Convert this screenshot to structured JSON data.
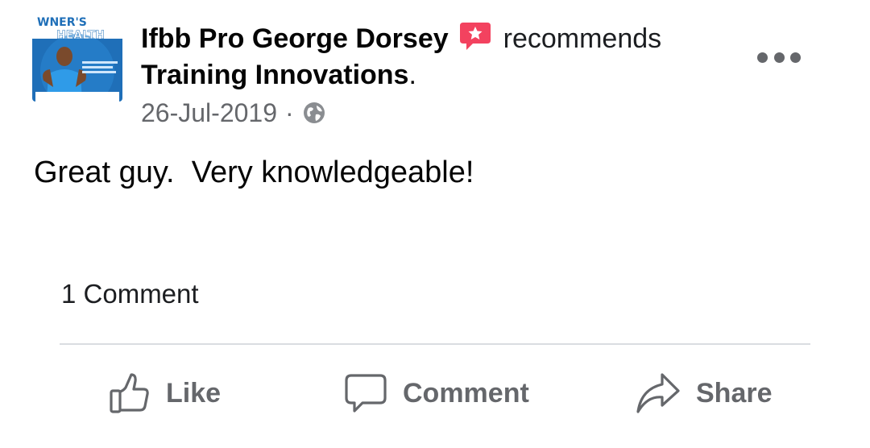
{
  "header": {
    "avatar_text_line1": "WNER'S",
    "avatar_text_line2": "HEALTH",
    "author": "Ifbb Pro George Dorsey",
    "recommend_icon": "recommend-star-icon",
    "verb": "recommends",
    "page_name": "Training Innovations",
    "page_suffix": ".",
    "date": "26-Jul-2019",
    "separator": "·",
    "privacy_icon": "globe-icon",
    "more_icon": "more-options-icon"
  },
  "body": {
    "text": "Great guy.  Very knowledgeable!"
  },
  "footer": {
    "comment_count": "1 Comment",
    "actions": [
      {
        "label": "Like",
        "icon": "thumbs-up-icon"
      },
      {
        "label": "Comment",
        "icon": "comment-bubble-icon"
      },
      {
        "label": "Share",
        "icon": "share-arrow-icon"
      }
    ]
  },
  "colors": {
    "recommend_red": "#f3425f",
    "secondary_text": "#65676b",
    "divider": "#dadde1",
    "avatar_blue": "#1f6fb8"
  }
}
